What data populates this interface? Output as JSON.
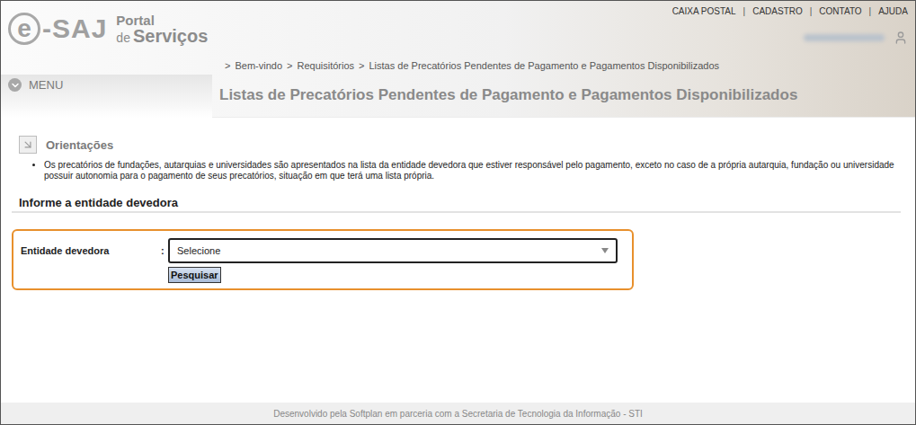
{
  "logo": {
    "mark": "e",
    "name": "-SAJ",
    "portal": "Portal",
    "de": "de",
    "servicos": "Serviços"
  },
  "top_links": {
    "items": [
      "CAIXA POSTAL",
      "CADASTRO",
      "CONTATO",
      "AJUDA"
    ],
    "separator": "|"
  },
  "breadcrumb": {
    "separator": ">",
    "items": [
      "Bem-vindo",
      "Requisitórios",
      "Listas de Precatórios Pendentes de Pagamento e Pagamentos Disponibilizados"
    ]
  },
  "menu": {
    "label": "MENU"
  },
  "page_title": "Listas de Precatórios Pendentes de Pagamento e Pagamentos Disponibilizados",
  "guidance": {
    "title": "Orientações",
    "items": [
      "Os precatórios de fundações, autarquias e universidades são apresentados na lista da entidade devedora que estiver responsável pelo pagamento, exceto no caso de a própria autarquia, fundação ou universidade possuir autonomia para o pagamento de seus precatórios, situação em que terá uma lista própria."
    ]
  },
  "form": {
    "title": "Informe a entidade devedora",
    "field_label": "Entidade devedora",
    "colon": ":",
    "select_value": "Selecione",
    "button": "Pesquisar"
  },
  "footer": "Desenvolvido pela Softplan em parceria com a Secretaria de Tecnologia da Informação - STI"
}
